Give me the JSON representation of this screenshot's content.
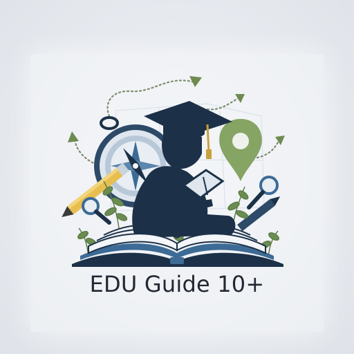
{
  "brand": {
    "title": "EDU Guide 10+"
  },
  "palette": {
    "navy": "#1c3148",
    "steel_blue": "#3d6b96",
    "leaf_green": "#6b8d52",
    "pin_green": "#86a464",
    "pencil_yellow": "#e7bf4f",
    "background": "#e7eaef",
    "text": "#222833"
  },
  "icons": [
    "graduation-cap-icon",
    "compass-icon",
    "map-pin-icon",
    "magnifier-icon",
    "pencil-icon",
    "open-book-icon",
    "reading-student-icon",
    "growth-arrow-icon",
    "plant-sprig-icon"
  ]
}
